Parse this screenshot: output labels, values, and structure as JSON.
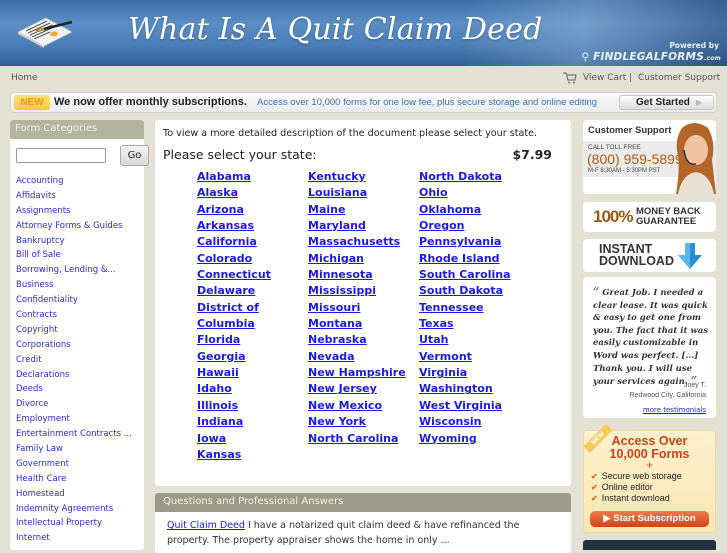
{
  "header": {
    "title": "What Is A Quit Claim Deed",
    "powered_by": "Powered by",
    "brand": "FINDLEGALFORMS",
    "brand_suffix": ".com"
  },
  "topnav": {
    "home": "Home",
    "view_cart": "View Cart",
    "separator": "|",
    "customer_support": "Customer Support"
  },
  "promo": {
    "badge": "NEW",
    "headline": "We now offer monthly subscriptions.",
    "text": "Access over 10,000 forms for one low fee, plus secure storage and online editing",
    "button": "Get Started",
    "button_arrow": "▶"
  },
  "sidebar": {
    "title": "Form Categories",
    "search_value": "",
    "go_label": "Go",
    "categories": [
      "Accounting",
      "Affidavits",
      "Assignments",
      "Attorney Forms & Guides",
      "Bankruptcy",
      "Bill of Sale",
      "Borrowing, Lending &...",
      "Business",
      "Confidentiality",
      "Contracts",
      "Copyright",
      "Corporations",
      "Credit",
      "Declarations",
      "Deeds",
      "Divorce",
      "Employment",
      "Entertainment Contracts ...",
      "Family Law",
      "Government",
      "Health Care",
      "Homestead",
      "Indemnity Agreements",
      "Intellectual Property",
      "Internet"
    ]
  },
  "main": {
    "intro": "To view a more detailed description of the document please select your state.",
    "select_label": "Please select your state:",
    "price": "$7.99",
    "states_col1": [
      "Alabama",
      "Alaska",
      "Arizona",
      "Arkansas",
      "California",
      "Colorado",
      "Connecticut",
      "Delaware",
      "District of",
      "Columbia",
      "Florida",
      "Georgia",
      "Hawaii",
      "Idaho",
      "Illinois",
      "Indiana",
      "Iowa",
      "Kansas"
    ],
    "states_col2": [
      "Kentucky",
      "Louisiana",
      "Maine",
      "Maryland",
      "Massachusetts",
      "Michigan",
      "Minnesota",
      "Mississippi",
      "Missouri",
      "Montana",
      "Nebraska",
      "Nevada",
      "New Hampshire",
      "New Jersey",
      "New Mexico",
      "New York",
      "North Carolina"
    ],
    "states_col3": [
      "North Dakota",
      "Ohio",
      "Oklahoma",
      "Oregon",
      "Pennsylvania",
      "Rhode Island",
      "South Carolina",
      "South Dakota",
      "Tennessee",
      "Texas",
      "Utah",
      "Vermont",
      "Virginia",
      "Washington",
      "West Virginia",
      "Wisconsin",
      "Wyoming"
    ]
  },
  "qa": {
    "title": "Questions and Professional Answers",
    "link": "Quit Claim Deed",
    "text": " I have a notarized quit claim deed & have refinanced the property. The property appraiser shows the home in only ..."
  },
  "right": {
    "support_title": "Customer Support",
    "toll_free": "CALL TOLL FREE",
    "phone": "(800) 959-5899",
    "hours": "M-F 8:30AM - 5:30PM PST",
    "guarantee_pct": "100%",
    "guarantee_line1": "MONEY BACK",
    "guarantee_line2": "GUARANTEE",
    "download_line1": "INSTANT",
    "download_line2": "DOWNLOAD",
    "quote_open": "“",
    "quote": "Great Job. I needed a clear lease. It was quick & easy to get one from you. The fact that it was easily customizable in Word was perfect. [...] Thank you. I will use your services again.",
    "quote_close": "”",
    "author_name": "Joey T.",
    "author_location": "Redwood City, California",
    "more_testimonials": "more testimonials",
    "sub_badge": "NEW",
    "sub_title_line1": "Access Over",
    "sub_title_line2": "10,000 Forms",
    "sub_plus": "+",
    "sub_features": [
      "Secure web storage",
      "Online editor",
      "Instant download"
    ],
    "sub_button": "▶ Start Subscription"
  },
  "colors": {
    "link": "#1a1ae6",
    "header_blue": "#4a7db5",
    "panel_head": "#9a9a86",
    "page_bg": "#e2e1d3",
    "accent_orange": "#cf4417"
  }
}
